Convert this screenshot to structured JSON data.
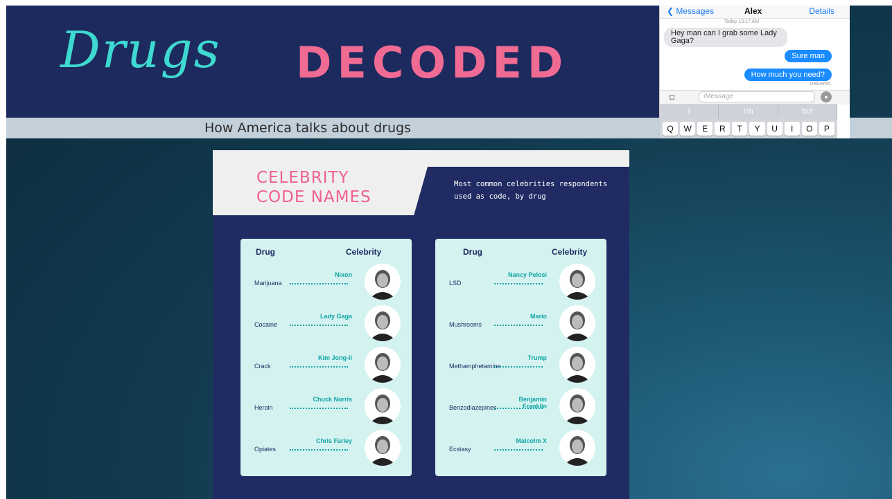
{
  "banner": {
    "title_script": "Drugs",
    "title_block": "DECODED",
    "subtitle": "How America talks about drugs"
  },
  "phone": {
    "back_label": "Messages",
    "contact": "Alex",
    "details_label": "Details",
    "timestamp": "Today 10:17 AM",
    "incoming_message": "Hey man can I grab some Lady Gaga?",
    "outgoing_messages": [
      "Sure man",
      "How much you need?"
    ],
    "delivered_label": "Delivered",
    "input_placeholder": "iMessage",
    "suggestions": [
      "I",
      "I'm",
      "but"
    ],
    "keys": [
      "Q",
      "W",
      "E",
      "R",
      "T",
      "Y",
      "U",
      "I",
      "O",
      "P"
    ]
  },
  "infographic": {
    "title_line1": "CELEBRITY",
    "title_line2": "CODE NAMES",
    "description": "Most common celebrities respondents used as code, by drug",
    "col_drug": "Drug",
    "col_celebrity": "Celebrity",
    "left_rows": [
      {
        "drug": "Marijuana",
        "celebrity": "Nixon"
      },
      {
        "drug": "Cocaine",
        "celebrity": "Lady Gaga"
      },
      {
        "drug": "Crack",
        "celebrity": "Kim Jong-Il"
      },
      {
        "drug": "Heroin",
        "celebrity": "Chuck Norris"
      },
      {
        "drug": "Opiates",
        "celebrity": "Chris Farley"
      }
    ],
    "right_rows": [
      {
        "drug": "LSD",
        "celebrity": "Nancy Pelosi"
      },
      {
        "drug": "Mushrooms",
        "celebrity": "Mario"
      },
      {
        "drug": "Methamphetamine",
        "celebrity": "Trump"
      },
      {
        "drug": "Benzodiazepines",
        "celebrity": "Benjamin Franklin"
      },
      {
        "drug": "Ecstasy",
        "celebrity": "Malcolm X"
      }
    ]
  },
  "colors": {
    "banner_bg": "#1d2a5e",
    "script_teal": "#3ed9d0",
    "accent_pink": "#f06b93",
    "panel_bg": "#d4f3f0",
    "celeb_teal": "#11a5a6"
  }
}
